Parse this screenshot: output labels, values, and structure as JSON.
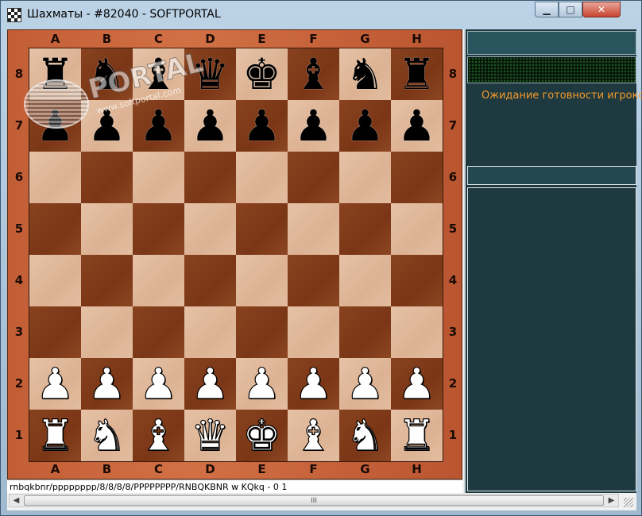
{
  "window": {
    "title": "Шахматы - #82040 - SOFTPORTAL",
    "icon": "chessboard-icon",
    "controls": {
      "minimize": "minimize-icon",
      "maximize": "maximize-icon",
      "close": "close-icon"
    }
  },
  "watermark": {
    "text": "PORTAL",
    "sub": "www.softportal.com"
  },
  "board": {
    "files": [
      "A",
      "B",
      "C",
      "D",
      "E",
      "F",
      "G",
      "H"
    ],
    "ranks": [
      "8",
      "7",
      "6",
      "5",
      "4",
      "3",
      "2",
      "1"
    ],
    "light_color": "#dcb293",
    "dark_color": "#7a3616",
    "position": [
      [
        "r",
        "n",
        "b",
        "q",
        "k",
        "b",
        "n",
        "r"
      ],
      [
        "p",
        "p",
        "p",
        "p",
        "p",
        "p",
        "p",
        "p"
      ],
      [
        "",
        "",
        "",
        "",
        "",
        "",
        "",
        ""
      ],
      [
        "",
        "",
        "",
        "",
        "",
        "",
        "",
        ""
      ],
      [
        "",
        "",
        "",
        "",
        "",
        "",
        "",
        ""
      ],
      [
        "",
        "",
        "",
        "",
        "",
        "",
        "",
        ""
      ],
      [
        "P",
        "P",
        "P",
        "P",
        "P",
        "P",
        "P",
        "P"
      ],
      [
        "R",
        "N",
        "B",
        "Q",
        "K",
        "B",
        "N",
        "R"
      ]
    ]
  },
  "side_panel": {
    "status": "Ожидание готовности игроков",
    "accent_color": "#f59a2a"
  },
  "status_bar": {
    "fen": "rnbqkbnr/pppppppp/8/8/8/8/PPPPPPPP/RNBQKBNR w KQkq - 0 1"
  },
  "scrollbar": {
    "thumb_grip": "III"
  }
}
